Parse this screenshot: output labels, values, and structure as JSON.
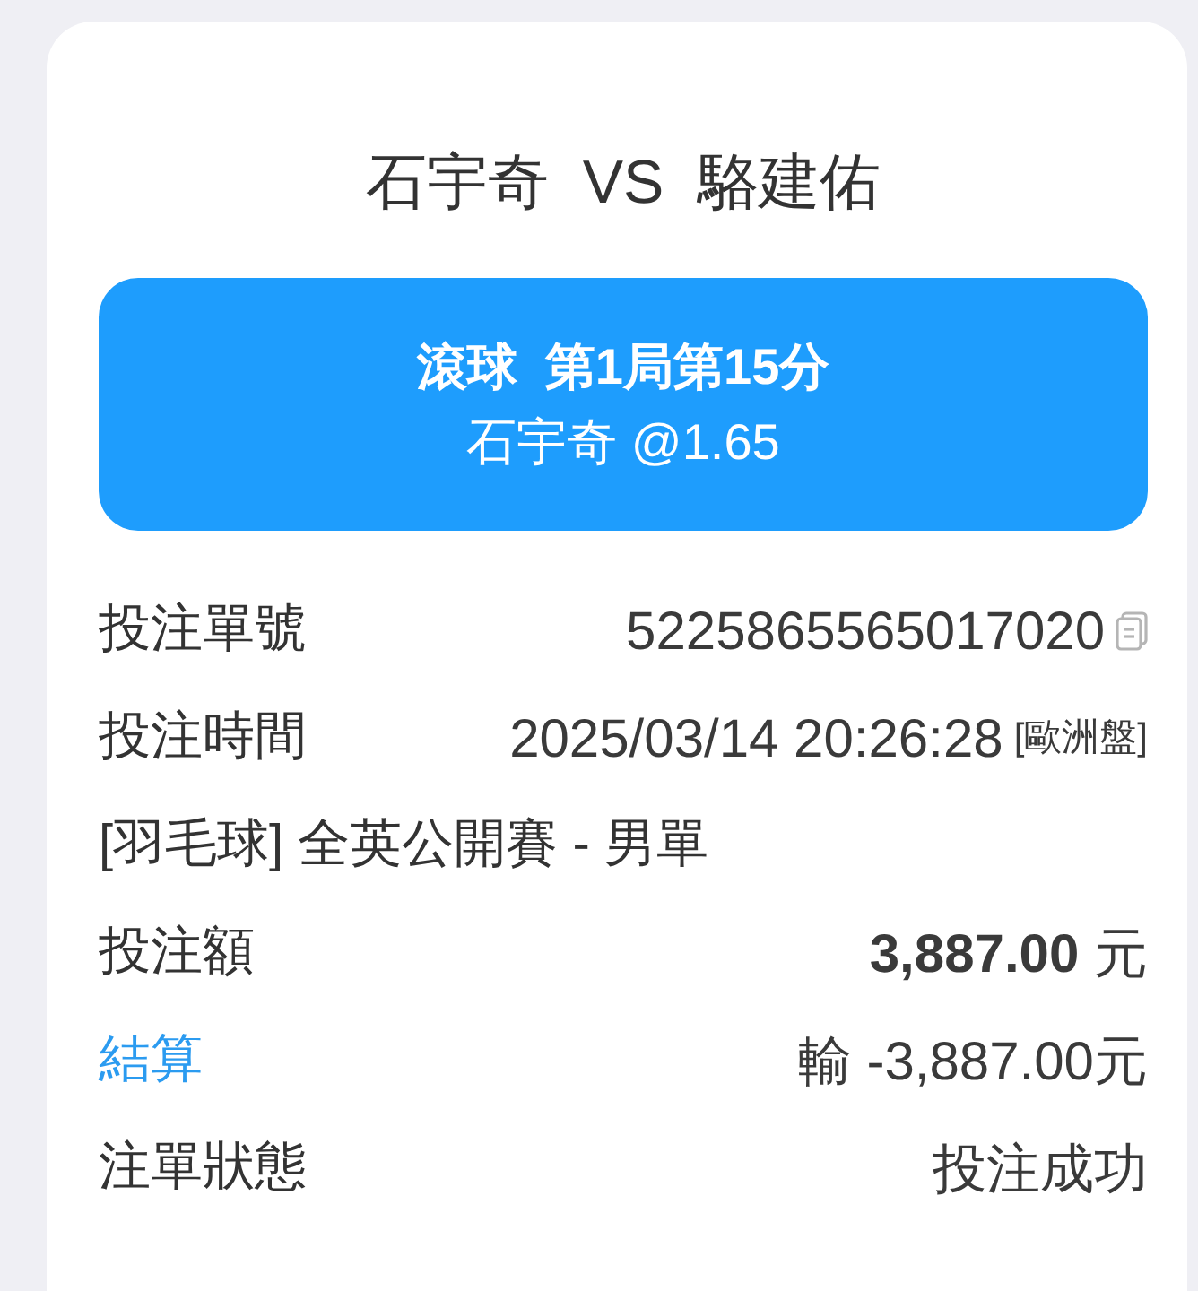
{
  "match": {
    "title": "石宇奇  VS  駱建佑"
  },
  "bet_banner": {
    "market": "滾球  第1局第15分",
    "selection": "石宇奇 @1.65"
  },
  "details": [
    {
      "kind": "pair",
      "label": "投注單號",
      "value": "5225865565017020",
      "copyable": true,
      "highlighted": false
    },
    {
      "kind": "pair",
      "label": "投注時間",
      "value": "2025/03/14 20:26:28",
      "tag": "[歐洲盤]",
      "copyable": false,
      "highlighted": false
    },
    {
      "kind": "line",
      "text": "[羽毛球] 全英公開賽 - 男單"
    },
    {
      "kind": "pair",
      "label": "投注額",
      "value": "**3,887.00** 元",
      "copyable": false,
      "highlighted": false
    },
    {
      "kind": "pair",
      "label": "結算",
      "value": "輸 -3,887.00元",
      "copyable": false,
      "highlighted": true
    },
    {
      "kind": "pair",
      "label": "注單狀態",
      "value": "投注成功",
      "copyable": false,
      "highlighted": false
    }
  ]
}
